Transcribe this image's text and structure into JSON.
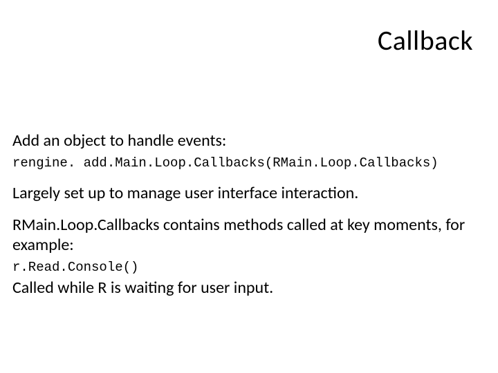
{
  "title": "Callback",
  "p1": "Add an object to handle events:",
  "code1": "rengine. add.Main.Loop.Callbacks(RMain.Loop.Callbacks)",
  "p2": "Largely set up to manage user interface interaction.",
  "p3": "RMain.Loop.Callbacks contains methods called at key moments, for example:",
  "code2": "r.Read.Console()",
  "p4": "Called while R is waiting for user input."
}
